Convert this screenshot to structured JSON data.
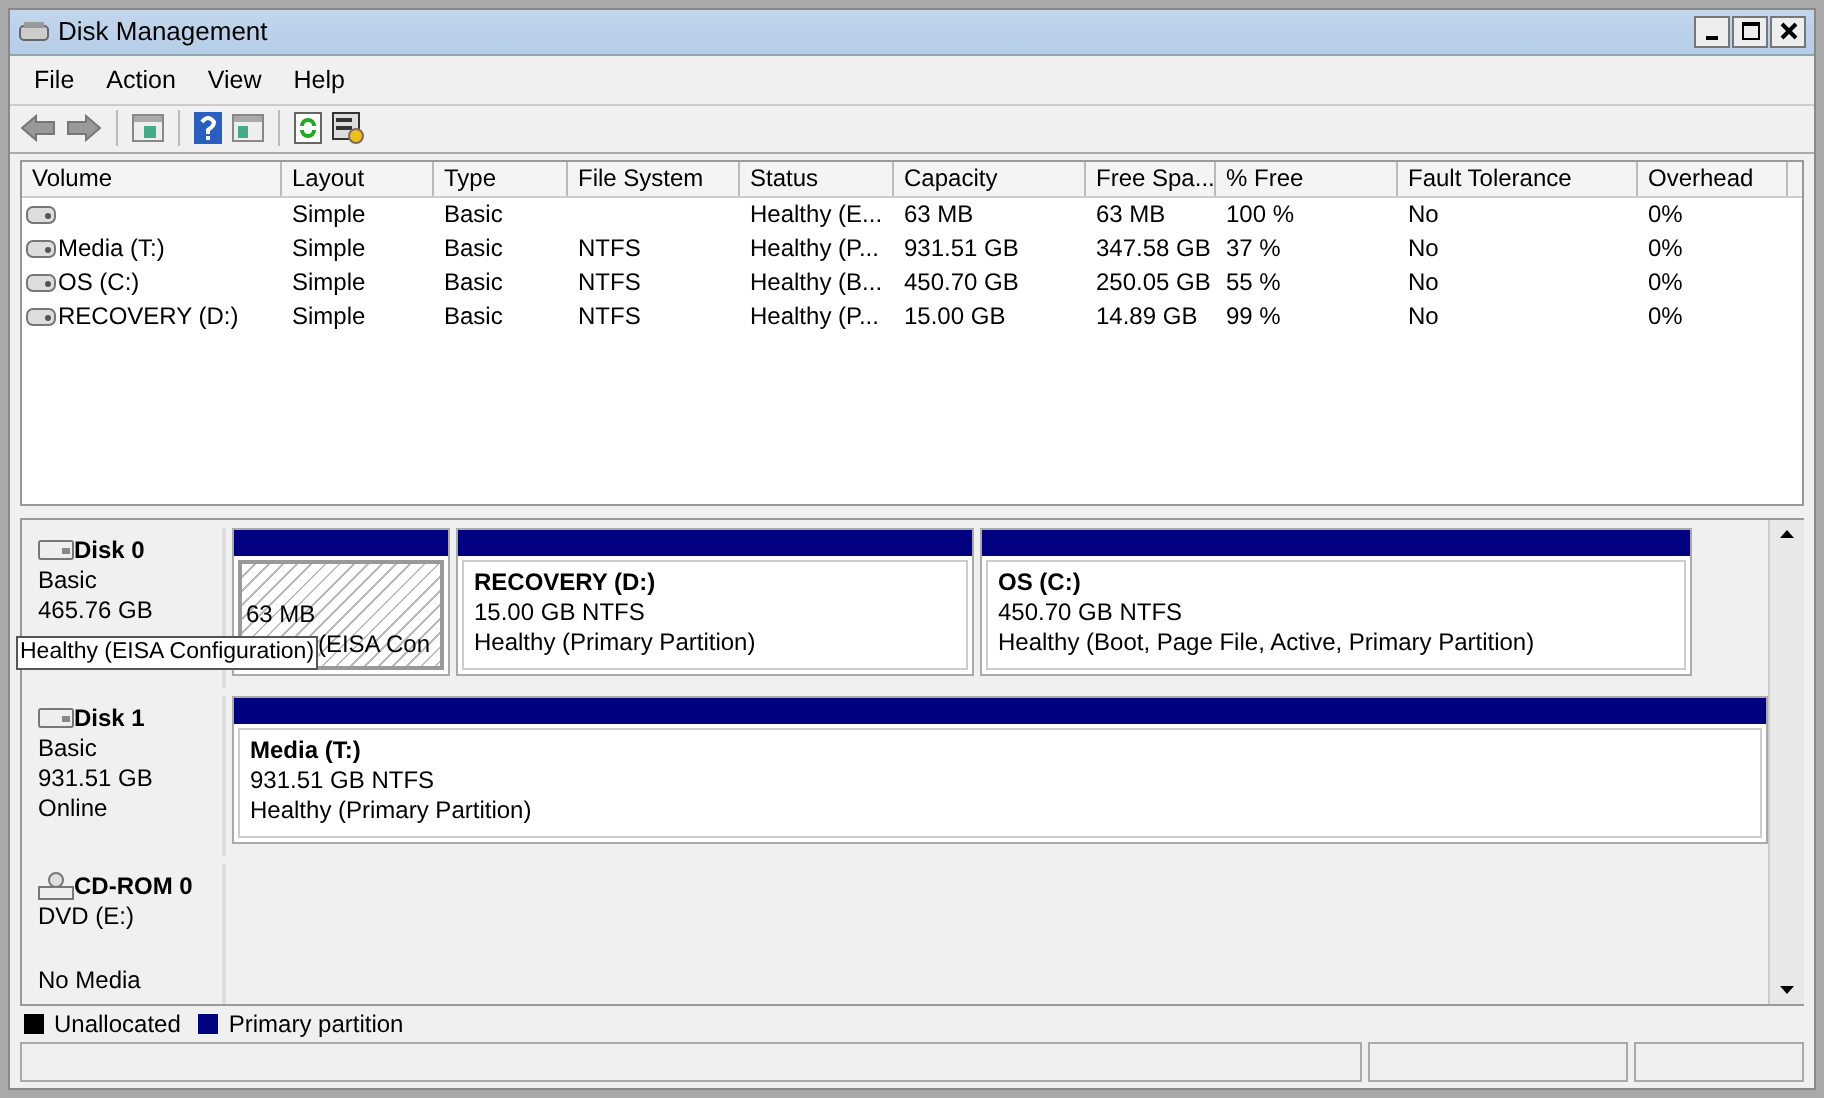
{
  "window": {
    "title": "Disk Management"
  },
  "menu": [
    {
      "label": "File"
    },
    {
      "label": "Action"
    },
    {
      "label": "View"
    },
    {
      "label": "Help"
    }
  ],
  "volume_table": {
    "columns": [
      "Volume",
      "Layout",
      "Type",
      "File System",
      "Status",
      "Capacity",
      "Free Spa...",
      "% Free",
      "Fault Tolerance",
      "Overhead"
    ],
    "rows": [
      {
        "cells": [
          null,
          "Simple",
          "Basic",
          null,
          "Healthy (E...",
          "63 MB",
          "63 MB",
          "100 %",
          "No",
          "0%"
        ]
      },
      {
        "cells": [
          "Media (T:)",
          "Simple",
          "Basic",
          "NTFS",
          "Healthy (P...",
          "931.51 GB",
          "347.58 GB",
          "37 %",
          "No",
          "0%"
        ]
      },
      {
        "cells": [
          "OS (C:)",
          "Simple",
          "Basic",
          "NTFS",
          "Healthy (B...",
          "450.70 GB",
          "250.05 GB",
          "55 %",
          "No",
          "0%"
        ]
      },
      {
        "cells": [
          "RECOVERY (D:)",
          "Simple",
          "Basic",
          "NTFS",
          "Healthy (P...",
          "15.00 GB",
          "14.89 GB",
          "99 %",
          "No",
          "0%"
        ]
      }
    ]
  },
  "disks": [
    {
      "kind": "disk",
      "name": "Disk 0",
      "lines": [
        "Basic",
        "465.76 GB"
      ],
      "partitions": [
        {
          "size": "63 MB",
          "status": "(EISA Con",
          "selected": true
        },
        {
          "name": "RECOVERY  (D:)",
          "size": "15.00 GB NTFS",
          "status": "Healthy (Primary Partition)",
          "selected": false
        },
        {
          "name": "OS  (C:)",
          "size": "450.70 GB NTFS",
          "status": "Healthy (Boot, Page File, Active, Primary Partition)",
          "selected": false
        }
      ]
    },
    {
      "kind": "disk",
      "name": "Disk 1",
      "lines": [
        "Basic",
        "931.51 GB",
        "Online"
      ],
      "partitions": [
        {
          "name": "Media  (T:)",
          "size": "931.51 GB NTFS",
          "status": "Healthy (Primary Partition)",
          "selected": false
        }
      ]
    },
    {
      "kind": "cdrom",
      "name": "CD-ROM 0",
      "lines": [
        "DVD (E:)"
      ],
      "footer": "No Media"
    }
  ],
  "tooltip": {
    "text": "Healthy (EISA Configuration)"
  },
  "legend": [
    {
      "label": "Unallocated",
      "color": "#000000"
    },
    {
      "label": "Primary partition",
      "color": "#000080"
    }
  ]
}
